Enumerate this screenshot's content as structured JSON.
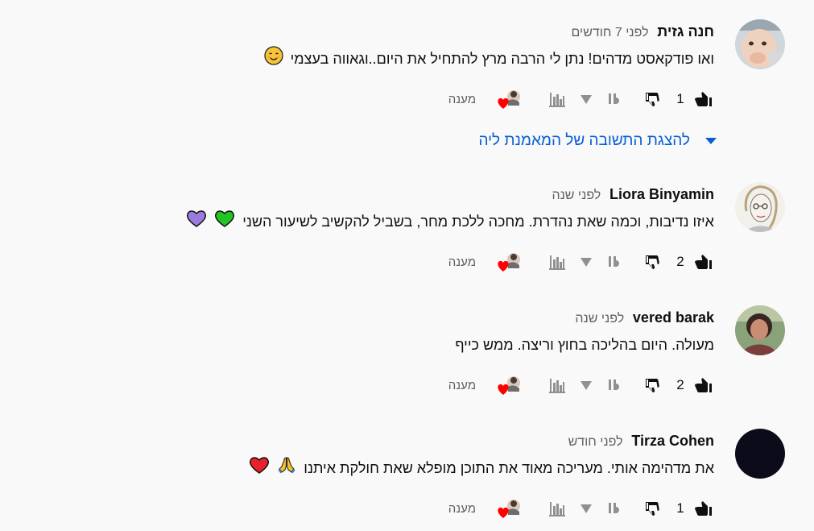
{
  "comments": [
    {
      "author": "חנה גזית",
      "time": "לפני 7 חודשים",
      "text": "ואו פודקאסט מדהים!  נתן לי הרבה מרץ להתחיל את היום..וגאווה בעצמי",
      "emojis": [
        "smiling-face"
      ],
      "likes": "1",
      "reply_label": "מענה",
      "avatar": "baby-photo"
    },
    {
      "author": "Liora Binyamin",
      "time": "לפני שנה",
      "text": "איזו נדיבות, וכמה שאת נהדרת. מחכה ללכת מחר, בשביל להקשיב לשיעור השני",
      "emojis": [
        "green-heart",
        "purple-heart"
      ],
      "likes": "2",
      "reply_label": "מענה",
      "avatar": "sketch-portrait"
    },
    {
      "author": "vered barak",
      "time": "לפני שנה",
      "text": "מעולה. היום בהליכה בחוץ וריצה. ממש כייף",
      "emojis": [],
      "likes": "2",
      "reply_label": "מענה",
      "avatar": "woman-photo"
    },
    {
      "author": "Tirza Cohen",
      "time": "לפני חודש",
      "text": "את מדהימה אותי. מעריכה מאוד את התוכן מופלא שאת חולקת איתנו",
      "emojis": [
        "folded-hands",
        "red-heart"
      ],
      "likes": "1",
      "reply_label": "מענה",
      "avatar": "dark-circle"
    }
  ],
  "replies_toggle": {
    "label": "להצגת התשובה של המאמנת ליה"
  },
  "colors": {
    "link": "#065fd4",
    "muted": "#606060",
    "icon_gray": "#909090",
    "heart": "#ff0000",
    "background": "#f9f9f9"
  }
}
